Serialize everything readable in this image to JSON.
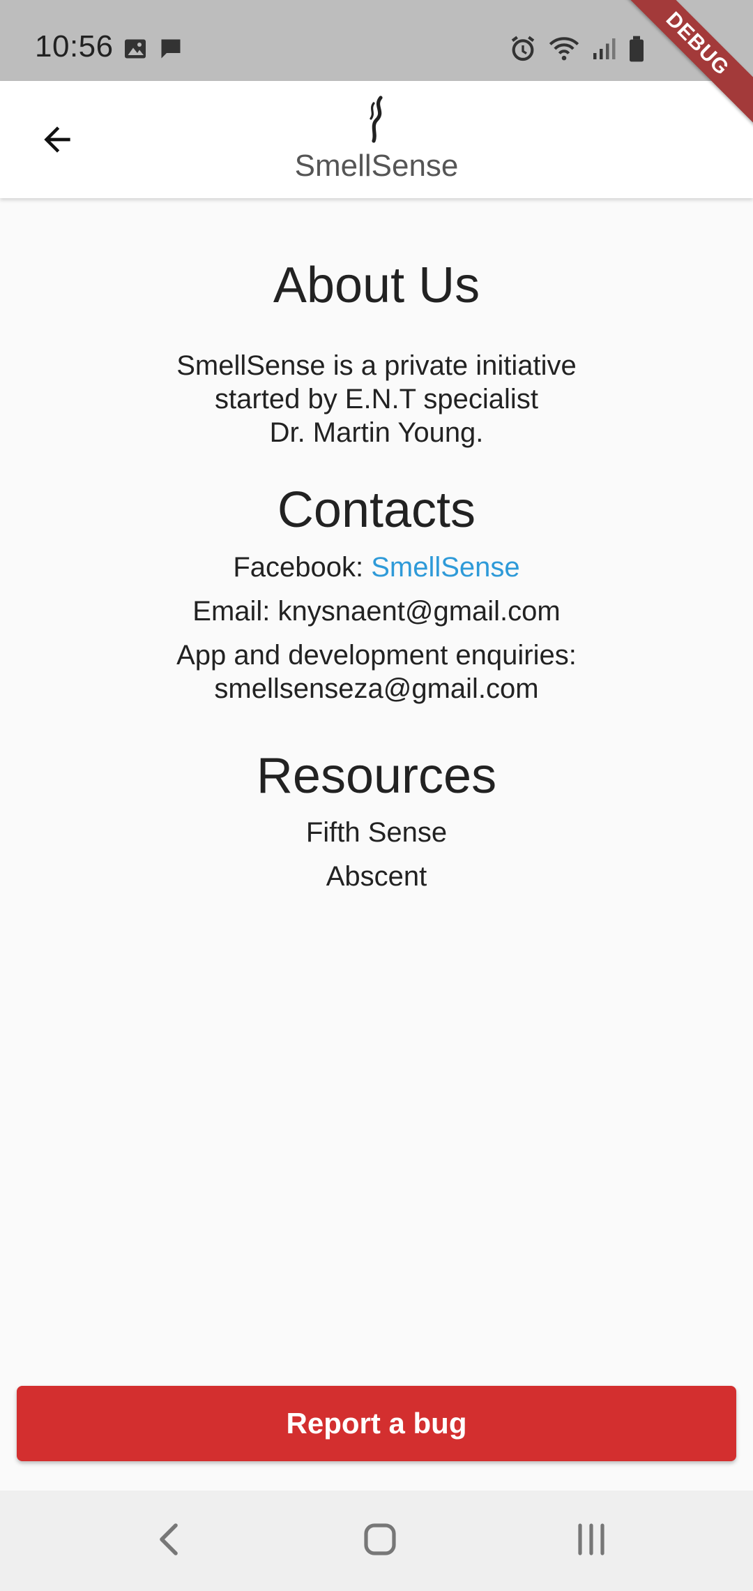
{
  "status_bar": {
    "time": "10:56",
    "left_icons": [
      "image-icon",
      "message-icon"
    ],
    "right_icons": [
      "alarm-icon",
      "wifi-icon",
      "signal-icon",
      "battery-icon"
    ]
  },
  "debug_banner": "DEBUG",
  "app_bar": {
    "back_icon": "arrow-back-icon",
    "logo_icon": "smell-wisp-icon",
    "brand": "SmellSense"
  },
  "about": {
    "title": "About Us",
    "lines": [
      "SmellSense is a private initiative",
      "started by E.N.T specialist",
      "Dr. Martin Young."
    ]
  },
  "contacts": {
    "title": "Contacts",
    "facebook_label": "Facebook: ",
    "facebook_link": "SmellSense",
    "email": "Email: knysnaent@gmail.com",
    "enquiries_label": "App and development enquiries:",
    "enquiries_email": "smellsenseza@gmail.com"
  },
  "resources": {
    "title": "Resources",
    "links": [
      "Fifth Sense",
      "Abscent"
    ]
  },
  "report_button": "Report a bug",
  "nav_bar": {
    "icons": [
      "nav-back-icon",
      "nav-home-icon",
      "nav-recents-icon"
    ]
  },
  "colors": {
    "accent_link": "#2e9ad8",
    "button_red": "#d32f2f",
    "status_bar_bg": "#bdbdbd",
    "debug_ribbon": "#a33a3a"
  }
}
